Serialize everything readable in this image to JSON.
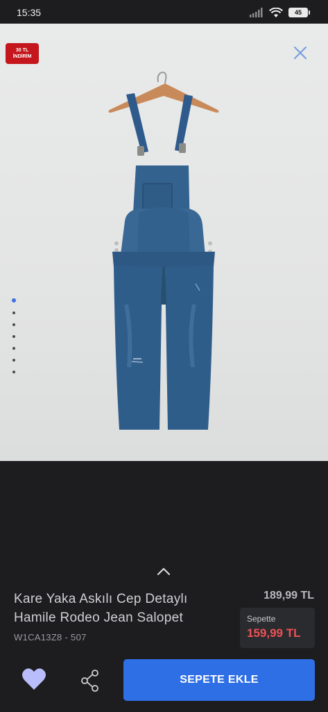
{
  "status_bar": {
    "time": "15:35",
    "battery": "45"
  },
  "gallery": {
    "discount_badge": {
      "line1": "30 TL",
      "line2": "İNDİRİM",
      "color": "#c4161c"
    },
    "close_icon": "close-icon",
    "image_count": 7,
    "active_index": 0
  },
  "product": {
    "title": "Kare Yaka Askılı Cep Detaylı Hamile Rodeo Jean Salopet",
    "code": "W1CA13Z8 - 507",
    "old_price": "189,99 TL",
    "basket_label": "Sepette",
    "basket_price": "159,99 TL"
  },
  "actions": {
    "add_to_cart_label": "SEPETE EKLE",
    "favorite_icon": "heart-icon",
    "share_icon": "share-icon"
  },
  "colors": {
    "accent": "#2f6fe6",
    "sale_price": "#ef5257",
    "favorite": "#b9bdfb",
    "background": "#1d1d1f"
  }
}
